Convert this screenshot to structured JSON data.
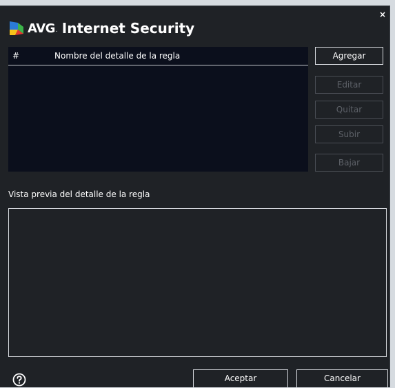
{
  "window": {
    "brand": "AVG",
    "product": "Internet Security",
    "close_label": "×"
  },
  "rules_table": {
    "columns": [
      "#",
      "Nombre del detalle de la regla"
    ],
    "rows": []
  },
  "side_buttons": {
    "add": "Agregar",
    "edit": "Editar",
    "remove": "Quitar",
    "up": "Subir",
    "down": "Bajar"
  },
  "preview": {
    "label": "Vista previa del detalle de la regla",
    "content": ""
  },
  "footer": {
    "help_icon": "help-icon",
    "accept": "Aceptar",
    "cancel": "Cancelar"
  },
  "colors": {
    "window_bg": "#1f2226",
    "panel_bg": "#0b0f1c",
    "disabled_text": "#5d6168",
    "border_light": "#d8dbe0"
  }
}
